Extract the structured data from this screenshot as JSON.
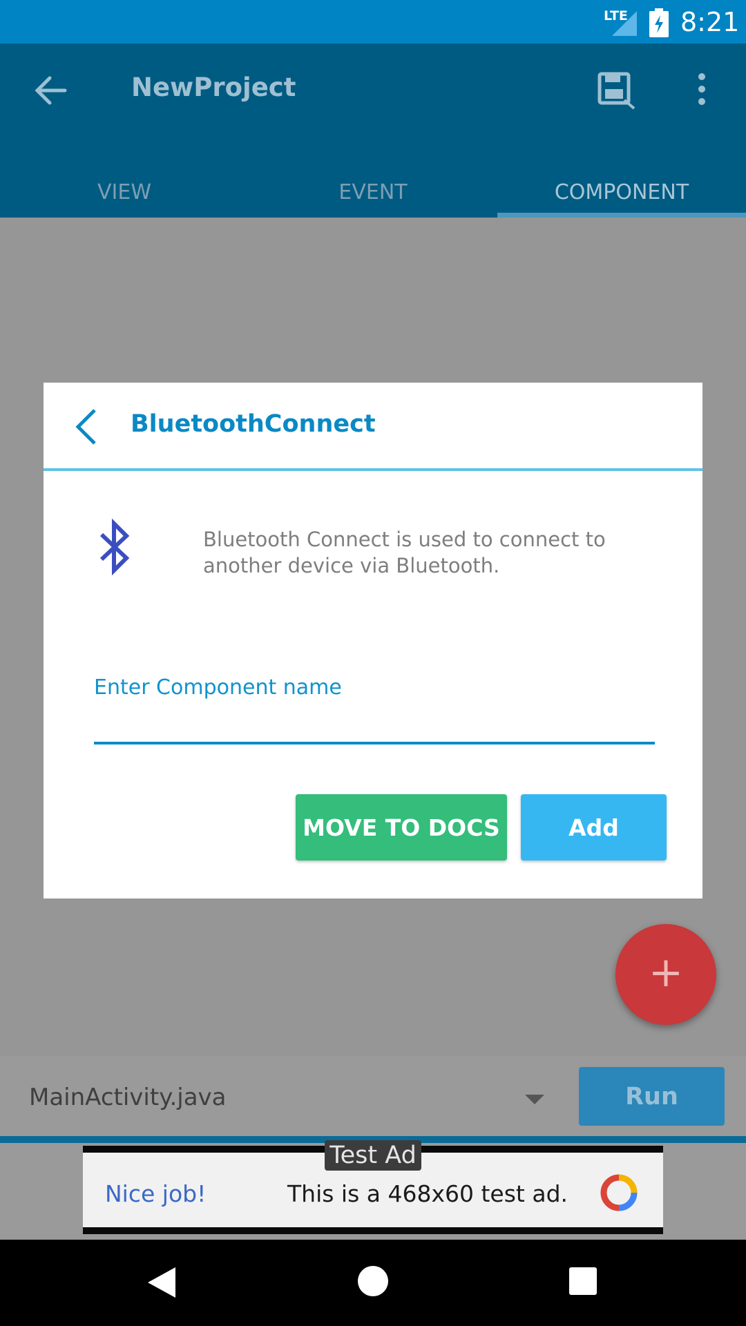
{
  "status_bar": {
    "network": "LTE",
    "time": "8:21"
  },
  "app_bar": {
    "title": "NewProject",
    "tabs": [
      {
        "label": "VIEW",
        "active": false
      },
      {
        "label": "EVENT",
        "active": false
      },
      {
        "label": "COMPONENT",
        "active": true
      }
    ]
  },
  "dialog": {
    "title": "BluetoothConnect",
    "description": "Bluetooth Connect is used to connect to another device via Bluetooth.",
    "input": {
      "label": "Enter Component name",
      "value": ""
    },
    "buttons": {
      "docs": "MOVE TO DOCS",
      "add": "Add"
    }
  },
  "fab": {
    "label": "+"
  },
  "bottom_bar": {
    "file": "MainActivity.java",
    "run": "Run"
  },
  "ad": {
    "tag": "Test Ad",
    "left_text": "Nice job!",
    "right_text": "This is a 468x60 test ad."
  },
  "colors": {
    "status_bar": "#0084c4",
    "app_bar": "#005b82",
    "accent": "#0a89c4",
    "docs_button": "#34bd7b",
    "add_button": "#37b7f2",
    "fab": "#c9383a",
    "run_button": "#2b86b9"
  }
}
